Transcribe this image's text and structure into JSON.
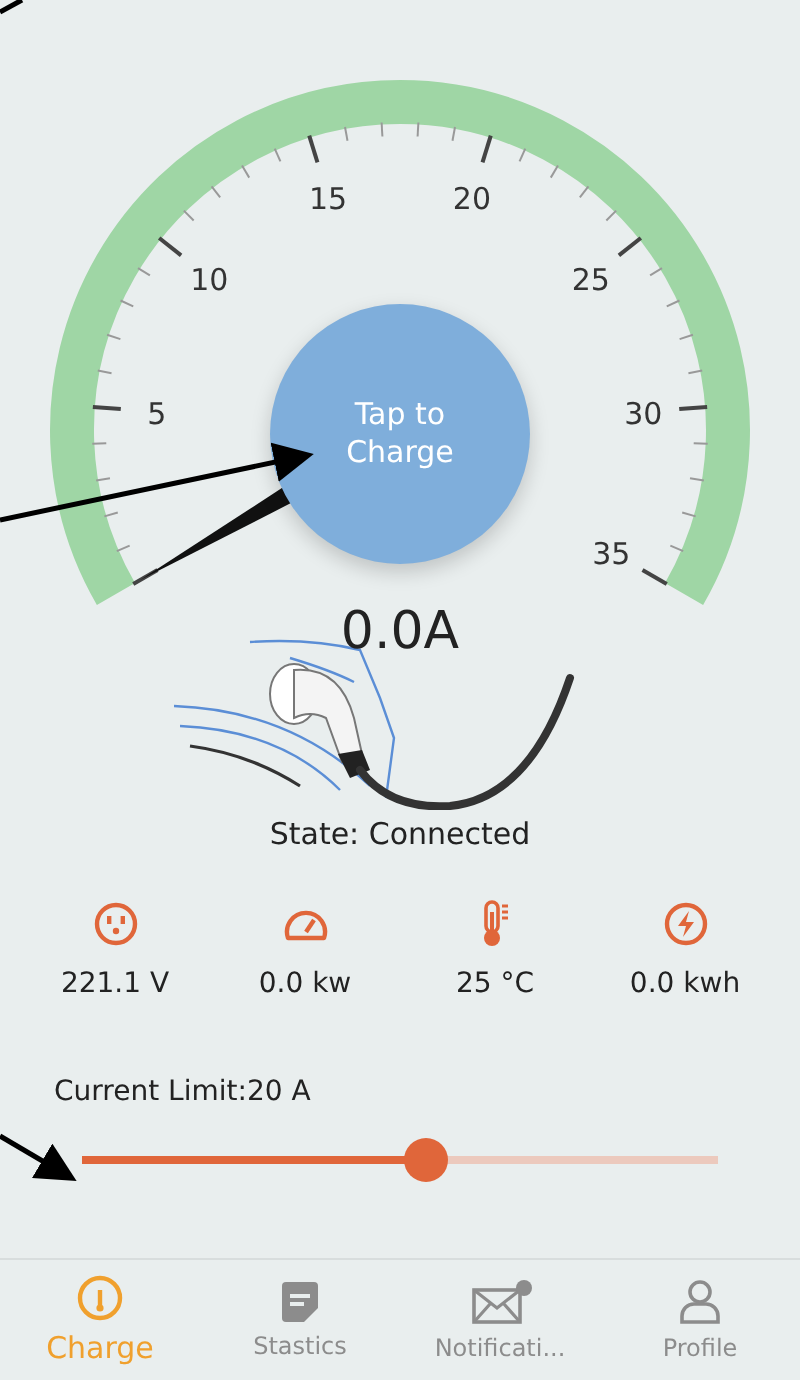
{
  "gauge": {
    "labels": [
      "5",
      "10",
      "15",
      "20",
      "25",
      "30",
      "35"
    ],
    "button": "Tap to Charge",
    "reading": "0.0A"
  },
  "state": "State: Connected",
  "stats": [
    {
      "kind": "socket",
      "value": "221.1 V"
    },
    {
      "kind": "speed",
      "value": "0.0 kw"
    },
    {
      "kind": "temperature",
      "value": "25 °C"
    },
    {
      "kind": "energy",
      "value": "0.0 kwh"
    }
  ],
  "current_limit": {
    "label": "Current Limit:20 A",
    "level": 0.54
  },
  "tabs": [
    {
      "kind": "charge",
      "label": "Charge",
      "selected": true,
      "badge": false
    },
    {
      "kind": "stats",
      "label": "Stastics",
      "selected": false,
      "badge": false
    },
    {
      "kind": "mail",
      "label": "Notificati...",
      "selected": false,
      "badge": true
    },
    {
      "kind": "profile",
      "label": "Profile",
      "selected": false,
      "badge": false
    }
  ]
}
